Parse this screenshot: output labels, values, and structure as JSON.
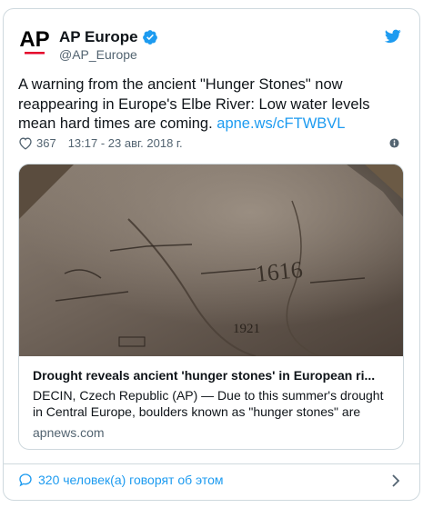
{
  "tweet": {
    "author": {
      "name": "AP Europe",
      "handle": "@AP_Europe",
      "avatar_text": "AP"
    },
    "text": "A warning from the ancient \"Hunger Stones\" now reappearing in Europe's Elbe River: Low water levels mean hard times are coming. ",
    "link": "apne.ws/cFTWBVL",
    "likes": "367",
    "timestamp": "13:17 - 23 авг. 2018 г.",
    "card": {
      "title": "Drought reveals ancient 'hunger stones' in European ri...",
      "description": "DECIN, Czech Republic (AP) — Due to this summer's drought in Central Europe, boulders known as \"hunger stones\" are",
      "domain": "apnews.com",
      "stone_carving_1": "1616",
      "stone_carving_2": "1921"
    },
    "footer": {
      "conversation": "320 человек(а) говорят об этом"
    }
  },
  "colors": {
    "accent": "#1d9bf0",
    "text": "#0f1419",
    "secondary": "#536471",
    "border": "#cfd9de",
    "ap_red": "#e4002b"
  },
  "icons": [
    "verified-badge-icon",
    "twitter-bird-icon",
    "heart-icon",
    "info-icon",
    "reply-bubble-icon",
    "chevron-right-icon"
  ]
}
